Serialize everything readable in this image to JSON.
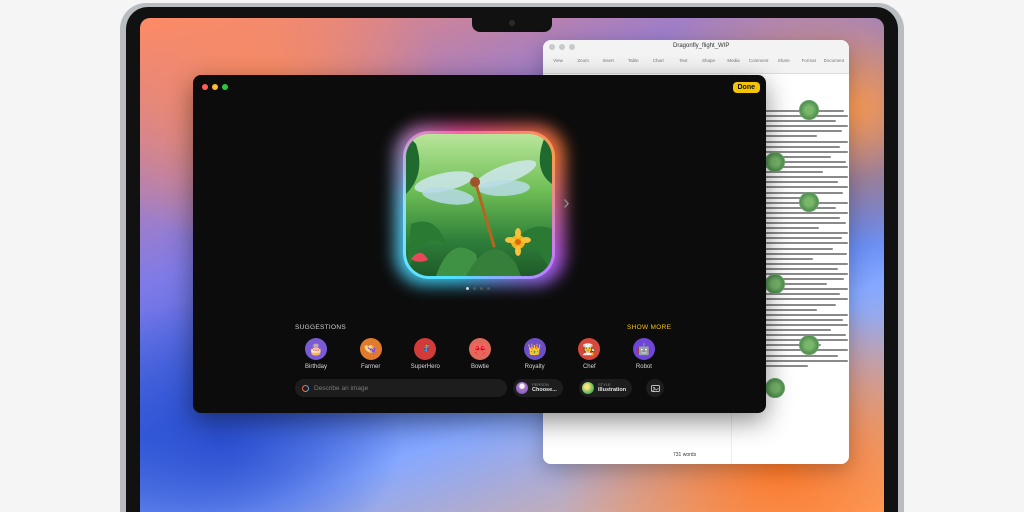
{
  "document": {
    "title": "Dragonfly_flight_WIP",
    "toolbar": [
      "View",
      "Zoom",
      "Insert",
      "Table",
      "Chart",
      "Text",
      "Shape",
      "Media",
      "Comment",
      "Share",
      "Format",
      "Document"
    ],
    "word_count": "731 words"
  },
  "playground": {
    "done_label": "Done",
    "suggestions_heading": "SUGGESTIONS",
    "show_more_label": "SHOW MORE",
    "suggestions": [
      {
        "label": "Birthday",
        "icon": "cake-icon",
        "color": "#7a5bd6",
        "glyph": "🎂"
      },
      {
        "label": "Farmer",
        "icon": "straw-hat-icon",
        "color": "#e07a2c",
        "glyph": "👒"
      },
      {
        "label": "SuperHero",
        "icon": "hero-mask-icon",
        "color": "#d33b3b",
        "glyph": "🦸"
      },
      {
        "label": "Bowtie",
        "icon": "bowtie-icon",
        "color": "#e06a5a",
        "glyph": "🎀"
      },
      {
        "label": "Royalty",
        "icon": "scepter-icon",
        "color": "#6c4fc4",
        "glyph": "👑"
      },
      {
        "label": "Chef",
        "icon": "chef-hat-icon",
        "color": "#d8483a",
        "glyph": "🧑‍🍳"
      },
      {
        "label": "Robot",
        "icon": "robot-icon",
        "color": "#6f46d8",
        "glyph": "🤖"
      }
    ],
    "prompt_placeholder": "Describe an image",
    "person_chip": {
      "label": "PERSON",
      "value": "Choose..."
    },
    "style_chip": {
      "label": "STYLE",
      "value": "Illustration"
    },
    "accent_color": "#f5c400"
  }
}
